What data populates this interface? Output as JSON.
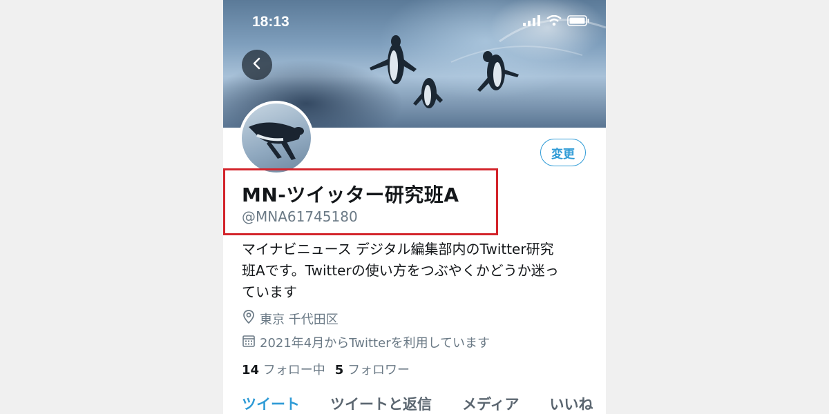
{
  "status_bar": {
    "time": "18:13",
    "signal_icon": "signal-bars-icon",
    "wifi_icon": "wifi-icon",
    "battery_icon": "battery-icon"
  },
  "header": {
    "back_icon": "chevron-left-icon"
  },
  "profile": {
    "edit_label": "変更",
    "display_name": "MN-ツイッター研究班A",
    "handle": "@MNA61745180",
    "bio_lines": [
      "マイナビニュース デジタル編集部内のTwitter研究",
      "班Aです。Twitterの使い方をつぶやくかどうか迷っ",
      "ています"
    ],
    "location": "東京 千代田区",
    "joined": "2021年4月からTwitterを利用しています",
    "following_count": "14",
    "following_label": "フォロー中",
    "followers_count": "5",
    "followers_label": "フォロワー"
  },
  "tabs": [
    {
      "label": "ツイート",
      "active": true
    },
    {
      "label": "ツイートと返信",
      "active": false
    },
    {
      "label": "メディア",
      "active": false
    },
    {
      "label": "いいね",
      "active": false
    }
  ],
  "colors": {
    "accent": "#2f9bd6",
    "highlight_box": "#d3242b",
    "page_background": "#f0f0f0"
  }
}
